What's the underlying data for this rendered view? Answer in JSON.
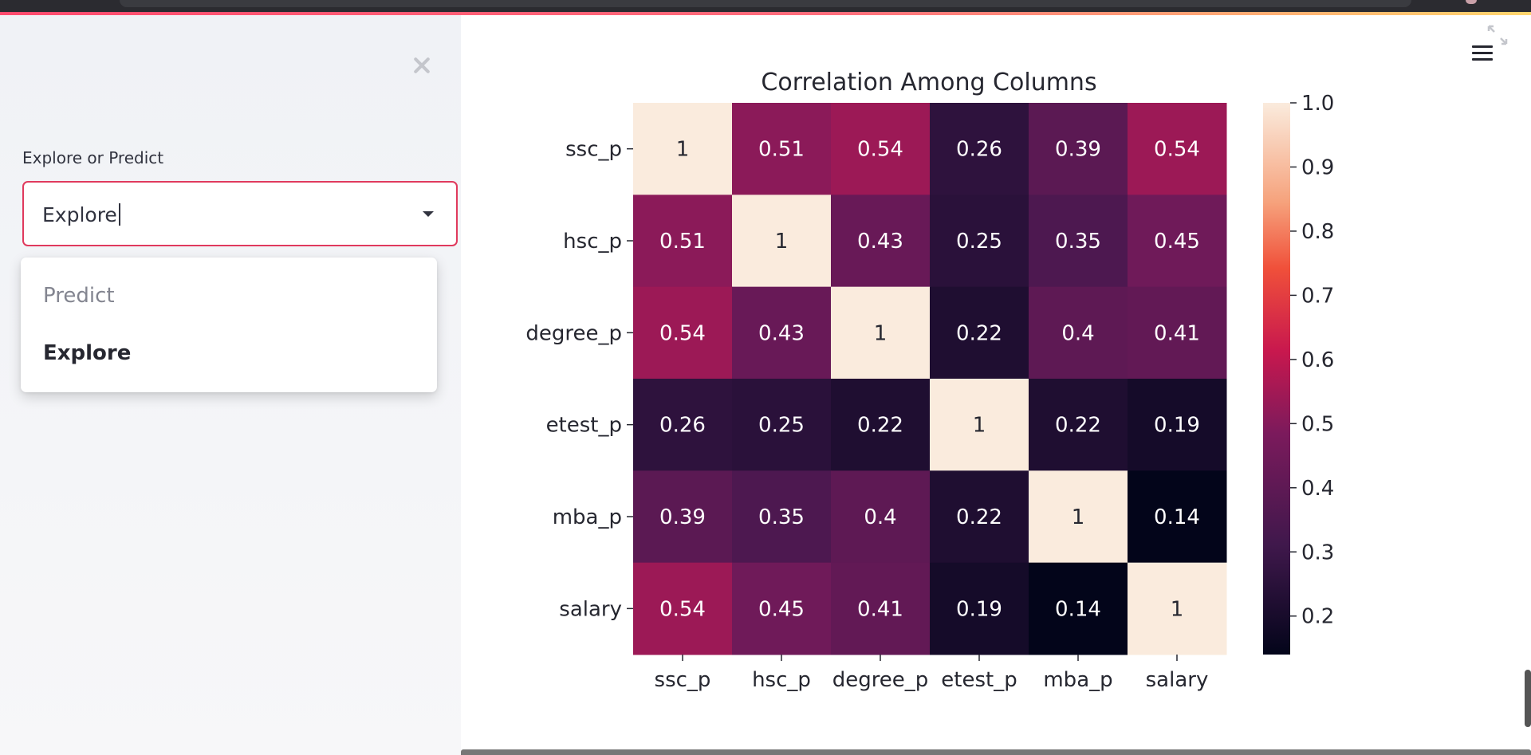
{
  "sidebar": {
    "select_label": "Explore or Predict",
    "select_value": "Explore",
    "options": [
      {
        "label": "Predict",
        "selected": false
      },
      {
        "label": "Explore",
        "selected": true
      }
    ]
  },
  "icons": {
    "close": "close-icon",
    "menu": "hamburger-menu-icon",
    "fullscreen": "fullscreen-icon",
    "dropdown": "chevron-down-icon"
  },
  "colors": {
    "accent": "#e03a5d",
    "sidebar_bg": "#f0f2f6",
    "text": "#31333f"
  },
  "chart_data": {
    "type": "heatmap",
    "title": "Correlation Among Columns",
    "rows": [
      "ssc_p",
      "hsc_p",
      "degree_p",
      "etest_p",
      "mba_p",
      "salary"
    ],
    "columns": [
      "ssc_p",
      "hsc_p",
      "degree_p",
      "etest_p",
      "mba_p",
      "salary"
    ],
    "values": [
      [
        1,
        0.51,
        0.54,
        0.26,
        0.39,
        0.54
      ],
      [
        0.51,
        1,
        0.43,
        0.25,
        0.35,
        0.45
      ],
      [
        0.54,
        0.43,
        1,
        0.22,
        0.4,
        0.41
      ],
      [
        0.26,
        0.25,
        0.22,
        1,
        0.22,
        0.19
      ],
      [
        0.39,
        0.35,
        0.4,
        0.22,
        1,
        0.14
      ],
      [
        0.54,
        0.45,
        0.41,
        0.19,
        0.14,
        1
      ]
    ],
    "colorbar": {
      "range": [
        0.14,
        1.0
      ],
      "ticks": [
        "1.0",
        "0.9",
        "0.8",
        "0.7",
        "0.6",
        "0.5",
        "0.4",
        "0.3",
        "0.2"
      ],
      "colormap": "rocket"
    },
    "annotated": true
  }
}
